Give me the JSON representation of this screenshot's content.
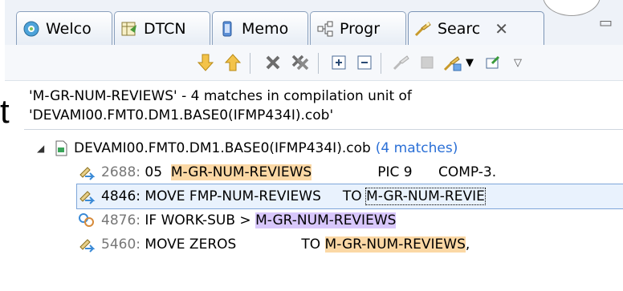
{
  "tabs": [
    {
      "label": "Welco",
      "icon": "welcome-icon"
    },
    {
      "label": "DTCN",
      "icon": "table-icon"
    },
    {
      "label": "Memo",
      "icon": "memory-icon"
    },
    {
      "label": "Progr",
      "icon": "program-icon"
    },
    {
      "label": "Searc",
      "icon": "search-icon",
      "active": true,
      "close": "✕"
    }
  ],
  "window_controls": {
    "minimize": "▭"
  },
  "ghost_text": "t",
  "search": {
    "summary_line1": "'M-GR-NUM-REVIEWS' - 4 matches in compilation unit of",
    "summary_line2": "'DEVAMI00.FMT0.DM1.BASE0(IFMP434I).cob'",
    "file": {
      "name": "DEVAMI00.FMT0.DM1.BASE0(IFMP434I).cob",
      "count": "(4 matches)",
      "expander": "◢"
    },
    "matches": [
      {
        "line": "2688:",
        "pre": " 05  ",
        "match": "M-GR-NUM-REVIEWS",
        "post": "PIC 9      COMP-3.",
        "icon": "read-access-icon"
      },
      {
        "line": "4846:",
        "pre": " MOVE FMP-NUM-REVIEWS     TO ",
        "match": "M-GR-NUM-REVIE",
        "post": "",
        "icon": "read-access-icon",
        "selected": true
      },
      {
        "line": "4876:",
        "pre": " IF WORK-SUB > ",
        "match": "M-GR-NUM-REVIEWS",
        "post": "",
        "icon": "write-access-icon"
      },
      {
        "line": "5460:",
        "pre": " MOVE ZEROS               TO ",
        "match": "M-GR-NUM-REVIEWS",
        "post": ",",
        "icon": "read-access-icon"
      }
    ]
  },
  "colors": {
    "match_highlight": "#fbd8a5",
    "write_highlight": "#d8c7fb",
    "count_text": "#2a6fd6",
    "line_number": "#777777"
  }
}
